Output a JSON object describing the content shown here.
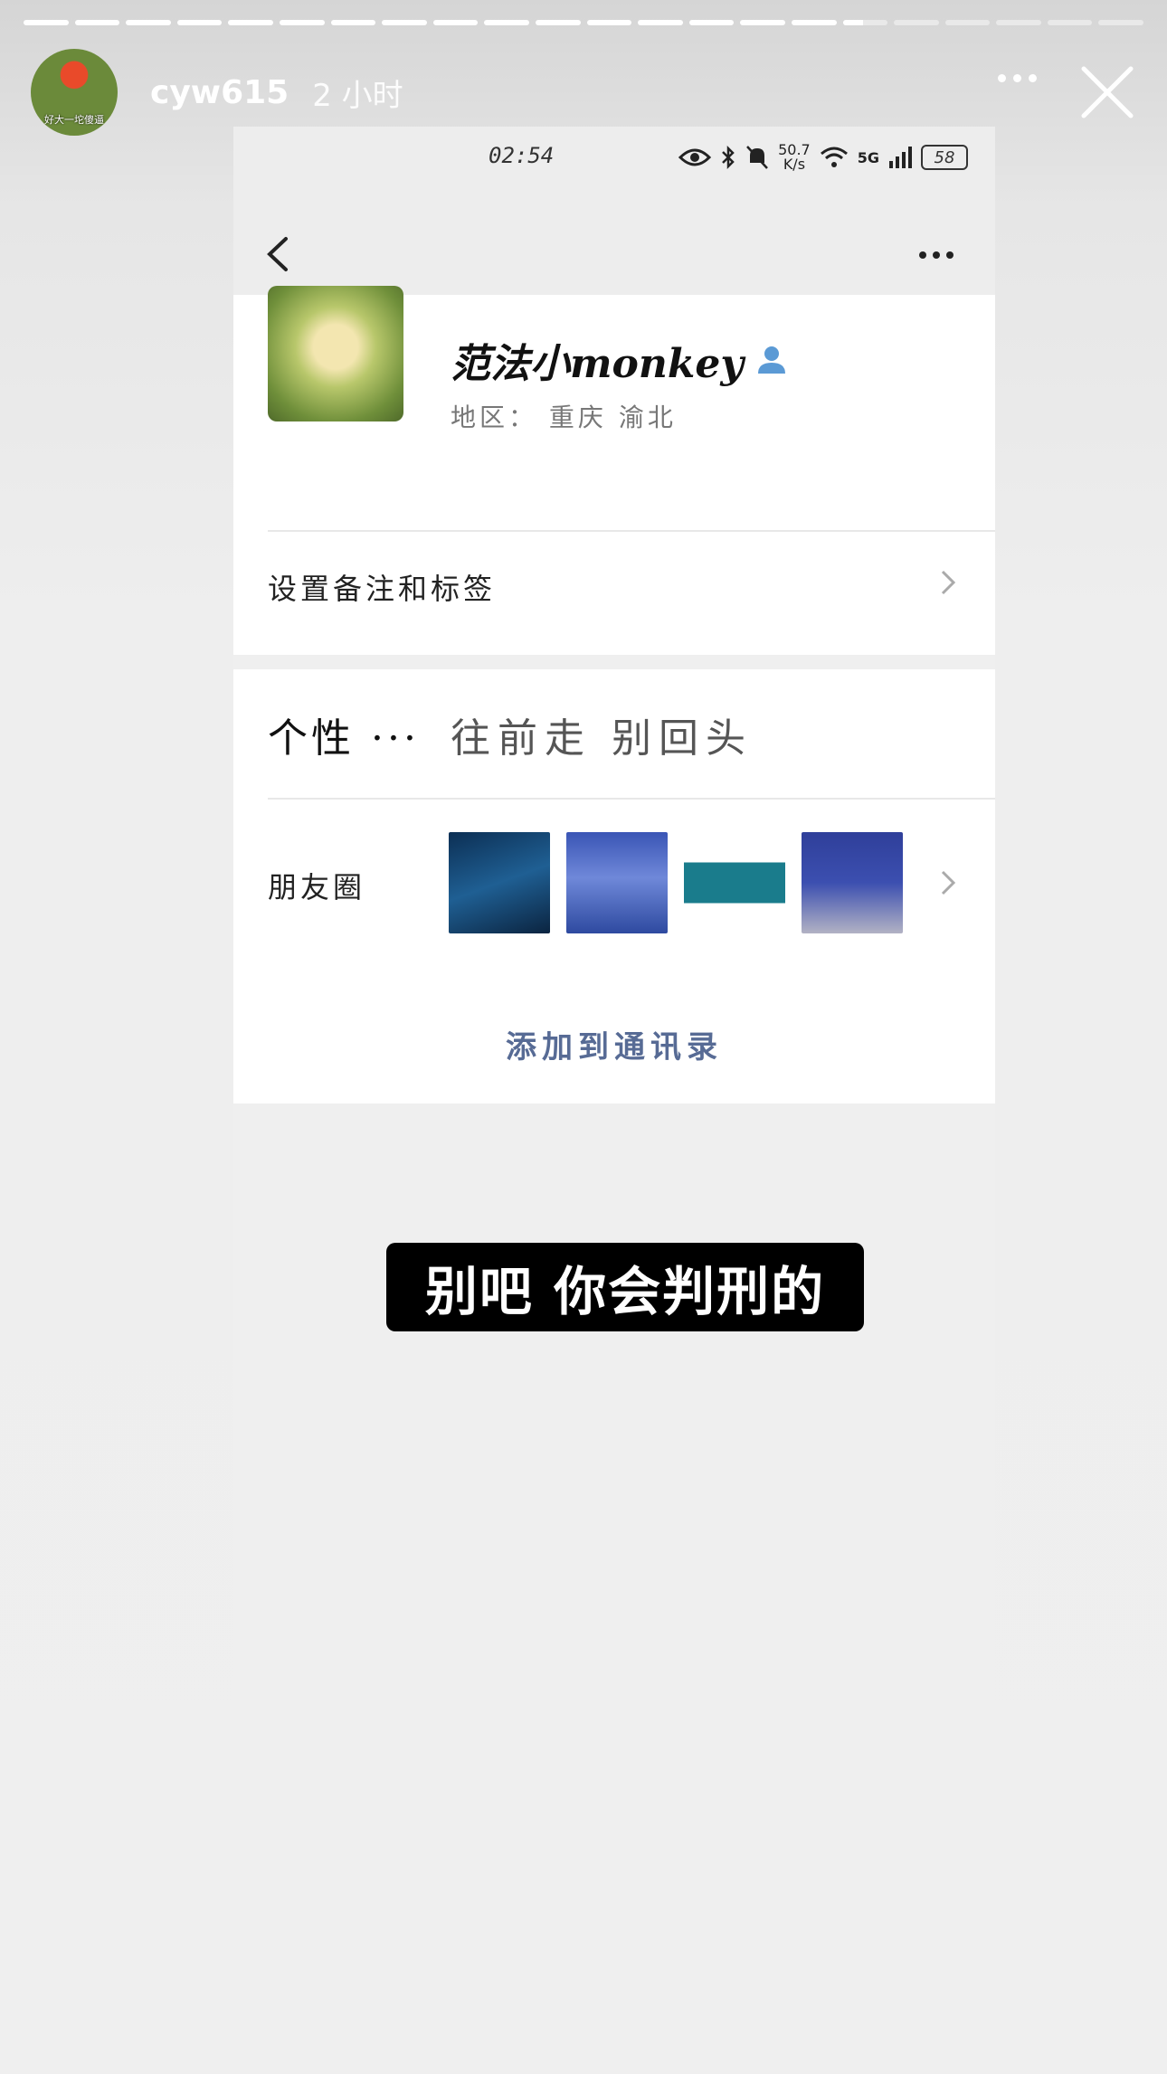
{
  "story": {
    "progress_segments_total": 22,
    "progress_active_index": 16,
    "username": "cyw615",
    "time_ago": "2 小时",
    "avatar_caption": "好大一坨傻逼",
    "caption": "别吧 你会判刑的"
  },
  "phone": {
    "status_time": "02:54",
    "network_speed_value": "50.7",
    "network_speed_unit": "K/s",
    "network_type": "5G",
    "battery": "58"
  },
  "profile": {
    "name": "范法小monkey",
    "region_label": "地区：",
    "region_value": "重庆  渝北",
    "set_remark": "设置备注和标签",
    "bio_label": "个性 ···",
    "bio_value": "往前走 别回头",
    "moments_label": "朋友圈",
    "add_contact": "添加到通讯录"
  },
  "colors": {
    "link_blue": "#576b95",
    "caption_bg": "#000000"
  }
}
